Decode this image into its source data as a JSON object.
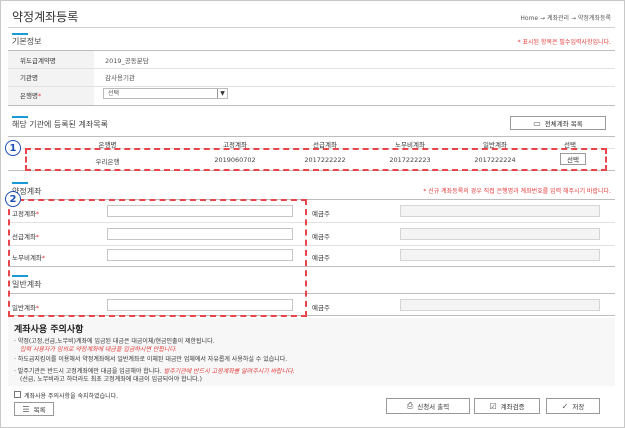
{
  "page": {
    "title": "약정계좌등록",
    "breadcrumb": "Home → 계좌관리 → 약정계좌등록"
  },
  "basic": {
    "section_title": "기본정보",
    "required_note": "* 표시된 항목은 필수입력사항입니다.",
    "rows": [
      {
        "label": "위도급계약명",
        "value": "2019_공동분담"
      },
      {
        "label": "기관명",
        "value": "감사용기관"
      },
      {
        "label": "은행명",
        "required_mark": "*",
        "select_value": "선택"
      }
    ]
  },
  "registered": {
    "section_title": "해당 기관에 등록된 계좌목록",
    "all_accounts_button": "전체계좌 목록",
    "columns": [
      "은행명",
      "고정계좌",
      "선급계좌",
      "노무비계좌",
      "일반계좌",
      "선택"
    ],
    "rows": [
      {
        "bank": "우리은행",
        "fixed": "2019060702",
        "advance": "2017222222",
        "labor": "2017222223",
        "general": "2017222224",
        "select_button": "선택"
      }
    ]
  },
  "agreement": {
    "section_title": "약정계좌",
    "warning": "* 신규 계좌등록의 경우 직접 은행명과 계좌번호를 입력 해주시기 바랍니다.",
    "rows": [
      {
        "label": "고정계좌",
        "required_mark": "*",
        "holder_label": "예금주"
      },
      {
        "label": "선급계좌",
        "required_mark": "*",
        "holder_label": "예금주"
      },
      {
        "label": "노무비계좌",
        "required_mark": "*",
        "holder_label": "예금주"
      }
    ]
  },
  "general": {
    "section_title": "일반계좌",
    "row": {
      "label": "일반계좌",
      "required_mark": "*",
      "holder_label": "예금주"
    }
  },
  "notes": {
    "title": "계좌사용 주의사항",
    "line1": "· 약정(고정,선급,노무비)계좌에 입금된 대금은 대금이체/현금인출이 제한됩니다.",
    "line1_red": "입력 사용자가 임의로 약정계좌에 대금을 입금하시면 안됩니다.",
    "line2": "· 하도급지킴이를 이용해서 약정계좌에서 일반계좌로 이체된 대금만 업체에서 자유롭게 사용하실 수 있습니다.",
    "line3": "· 발주기관은 반드시 고정계좌에만 대금을 입금해야 합니다.",
    "line3_red": "발주기관에 반드시 고정계좌를 알려주시기 바랍니다.",
    "line4": "(선급, 노무비라고 하더라도 최초 고정계좌에 대금이 입금되어야 합니다.)"
  },
  "agree_label": "계좌사용 주의사항을 숙지하였습니다.",
  "buttons": {
    "list": "목록",
    "print": "신청서 출력",
    "verify": "계좌검증",
    "save": "저장"
  },
  "badges": {
    "one": "1",
    "two": "2"
  },
  "colors": {
    "accent": "#1a9bd7",
    "highlight": "#e8454a",
    "badge": "#1c4fb3"
  },
  "icons": {
    "list": "list-icon",
    "print": "print-icon",
    "verify": "check-square-icon",
    "save": "check-icon",
    "accounts": "window-icon",
    "dropdown": "chevron-down-icon"
  }
}
